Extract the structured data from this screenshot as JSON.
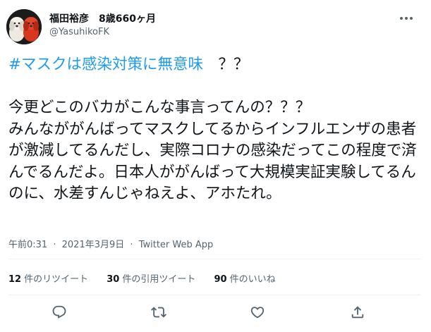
{
  "tweet": {
    "author_name": "福田裕彦　8歳660ヶ月",
    "author_handle": "@YasuhikoFK",
    "hashtag": "#マスクは感染対策に無意味",
    "text_after_hashtag": "　？？\n\n今更どこのバカがこんな事言ってんの？？？\nみんなががんばってマスクしてるからインフルエンザの患者が激減してるんだし、実際コロナの感染だってこの程度で済んでるんだよ。日本人ががんばって大規模実証実験してるんのに、水差すんじゃねえよ、アホたれ。",
    "time": "午前0:31",
    "date": "2021年3月9日",
    "separator": "·",
    "source": "Twitter Web App"
  },
  "stats": {
    "retweets_count": "12",
    "retweets_label": "件のリツイート",
    "quotes_count": "30",
    "quotes_label": "件の引用ツイート",
    "likes_count": "90",
    "likes_label": "件のいいね"
  },
  "icons": {
    "more": "more-icon",
    "reply": "reply-icon",
    "retweet": "retweet-icon",
    "like": "like-icon",
    "share": "share-icon"
  },
  "colors": {
    "hashtag": "#1d9bf0",
    "text": "#0f1419",
    "secondary": "#536471",
    "divider": "#eff3f4"
  }
}
